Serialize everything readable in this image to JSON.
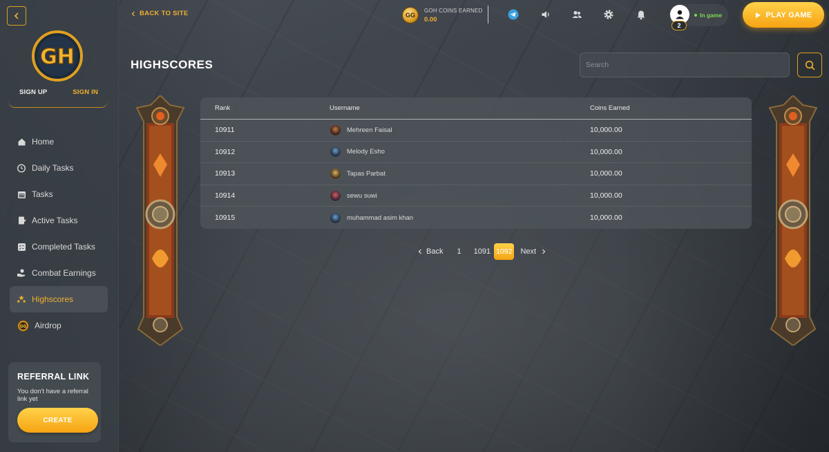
{
  "sidebar": {
    "logo_text": "GH",
    "signup": "SIGN UP",
    "signin": "SIGN IN",
    "items": [
      {
        "label": "Home",
        "icon": "home-icon"
      },
      {
        "label": "Daily Tasks",
        "icon": "timer-icon"
      },
      {
        "label": "Tasks",
        "icon": "calendar-icon"
      },
      {
        "label": "Active Tasks",
        "icon": "clipboard-icon"
      },
      {
        "label": "Completed Tasks",
        "icon": "checklist-icon"
      },
      {
        "label": "Combat Earnings",
        "icon": "hand-coins-icon"
      },
      {
        "label": "Highscores",
        "icon": "trophy-stars-icon",
        "active": true
      },
      {
        "label": "Airdrop",
        "icon": "gg-coin-icon"
      }
    ],
    "referral": {
      "title": "REFERRAL LINK",
      "text": "You don't have a referral link yet",
      "button": "CREATE"
    }
  },
  "topbar": {
    "back_label": "BACK TO SITE",
    "coin_badge": "GG",
    "coins_label": "GOH COINS EARNED",
    "coins_value": "0.00",
    "notification_count": "2",
    "status": "In game",
    "play_label": "PLAY GAME"
  },
  "main": {
    "title": "HIGHSCORES",
    "search_placeholder": "Search",
    "columns": {
      "rank": "Rank",
      "username": "Username",
      "coins": "Coins Earned"
    },
    "rows": [
      {
        "rank": "10911",
        "username": "Mehreen Faisal",
        "coins": "10,000.00"
      },
      {
        "rank": "10912",
        "username": "Melody Esho",
        "coins": "10,000.00"
      },
      {
        "rank": "10913",
        "username": "Tapas Parbat",
        "coins": "10,000.00"
      },
      {
        "rank": "10914",
        "username": "sewu suwi",
        "coins": "10,000.00"
      },
      {
        "rank": "10915",
        "username": "muhammad asim khan",
        "coins": "10,000.00"
      }
    ],
    "pagination": {
      "back": "Back",
      "pages": [
        "1",
        "1091",
        "1092"
      ],
      "current": "1092",
      "next": "Next"
    }
  },
  "colors": {
    "accent": "#f0b030",
    "accent_gradient_top": "#ffd24a",
    "accent_gradient_bottom": "#f6a312",
    "online": "#7ed957"
  }
}
